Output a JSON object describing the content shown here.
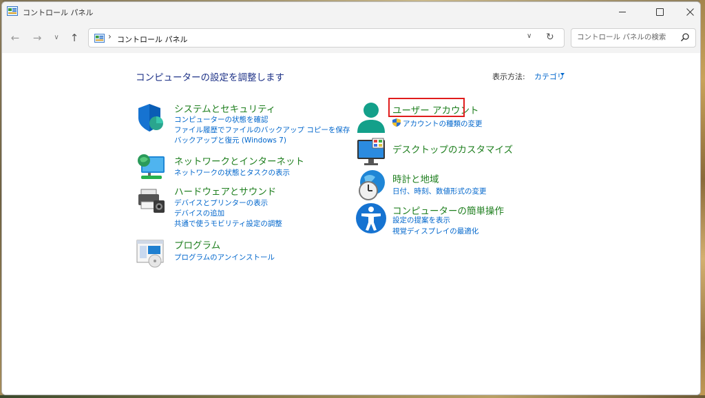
{
  "window": {
    "title": "コントロール パネル"
  },
  "address": {
    "path": "コントロール パネル",
    "separator": "›"
  },
  "search": {
    "placeholder": "コントロール パネルの検索"
  },
  "main": {
    "heading": "コンピューターの設定を調整します",
    "view_by_label": "表示方法:",
    "view_by_value": "カテゴリ"
  },
  "categories": {
    "system": {
      "title": "システムとセキュリティ",
      "links": [
        "コンピューターの状態を確認",
        "ファイル履歴でファイルのバックアップ コピーを保存",
        "バックアップと復元 (Windows 7)"
      ]
    },
    "network": {
      "title": "ネットワークとインターネット",
      "links": [
        "ネットワークの状態とタスクの表示"
      ]
    },
    "hardware": {
      "title": "ハードウェアとサウンド",
      "links": [
        "デバイスとプリンターの表示",
        "デバイスの追加",
        "共通で使うモビリティ設定の調整"
      ]
    },
    "programs": {
      "title": "プログラム",
      "links": [
        "プログラムのアンインストール"
      ]
    },
    "users": {
      "title": "ユーザー アカウント",
      "links": [
        "アカウントの種類の変更"
      ]
    },
    "appearance": {
      "title": "デスクトップのカスタマイズ",
      "links": []
    },
    "clock": {
      "title": "時計と地域",
      "links": [
        "日付、時刻、数値形式の変更"
      ]
    },
    "ease": {
      "title": "コンピューターの簡単操作",
      "links": [
        "設定の提案を表示",
        "視覚ディスプレイの最適化"
      ]
    }
  },
  "colors": {
    "category_title": "#1f7f1f",
    "link": "#0066cc",
    "heading": "#1e3287",
    "highlight_box": "#e01b1b"
  },
  "icons": [
    "control-panel-icon",
    "back-icon",
    "forward-icon",
    "recent-icon",
    "up-icon",
    "chevron-down-icon",
    "refresh-icon",
    "search-icon",
    "shield-icon",
    "network-icon",
    "printer-icon",
    "programs-icon",
    "user-icon",
    "uac-shield-icon",
    "monitor-icon",
    "clock-icon",
    "accessibility-icon"
  ]
}
